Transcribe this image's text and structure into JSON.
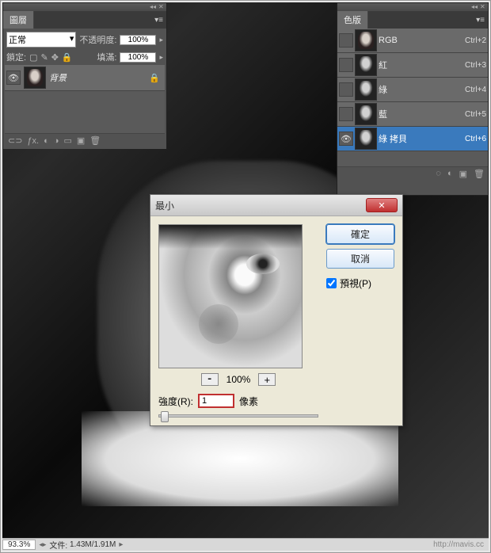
{
  "watermark": "Mavis",
  "url_mark": "http://mavis.cc",
  "layers_panel": {
    "tab": "圖層",
    "blend_mode": "正常",
    "opacity_label": "不透明度:",
    "opacity_value": "100%",
    "lock_label": "鎖定:",
    "fill_label": "填滿:",
    "fill_value": "100%",
    "layer": {
      "name": "背景",
      "locked": true,
      "visible": true
    },
    "footer_link_icon": "⊂⊃"
  },
  "channels_panel": {
    "tab": "色版",
    "channels": [
      {
        "name": "RGB",
        "shortcut": "Ctrl+2",
        "visible": false,
        "selected": false
      },
      {
        "name": "紅",
        "shortcut": "Ctrl+3",
        "visible": false,
        "selected": false
      },
      {
        "name": "綠",
        "shortcut": "Ctrl+4",
        "visible": false,
        "selected": false
      },
      {
        "name": "藍",
        "shortcut": "Ctrl+5",
        "visible": false,
        "selected": false
      },
      {
        "name": "綠 拷貝",
        "shortcut": "Ctrl+6",
        "visible": true,
        "selected": true
      }
    ]
  },
  "dialog": {
    "title": "最小",
    "ok": "確定",
    "cancel": "取消",
    "preview_label": "預視(P)",
    "preview_checked": true,
    "zoom": "100%",
    "radius_label": "強度(R):",
    "radius_value": "1",
    "radius_unit": "像素"
  },
  "status": {
    "zoom": "93.3%",
    "doc_label": "文件:",
    "doc_value": "1.43M/1.91M"
  }
}
